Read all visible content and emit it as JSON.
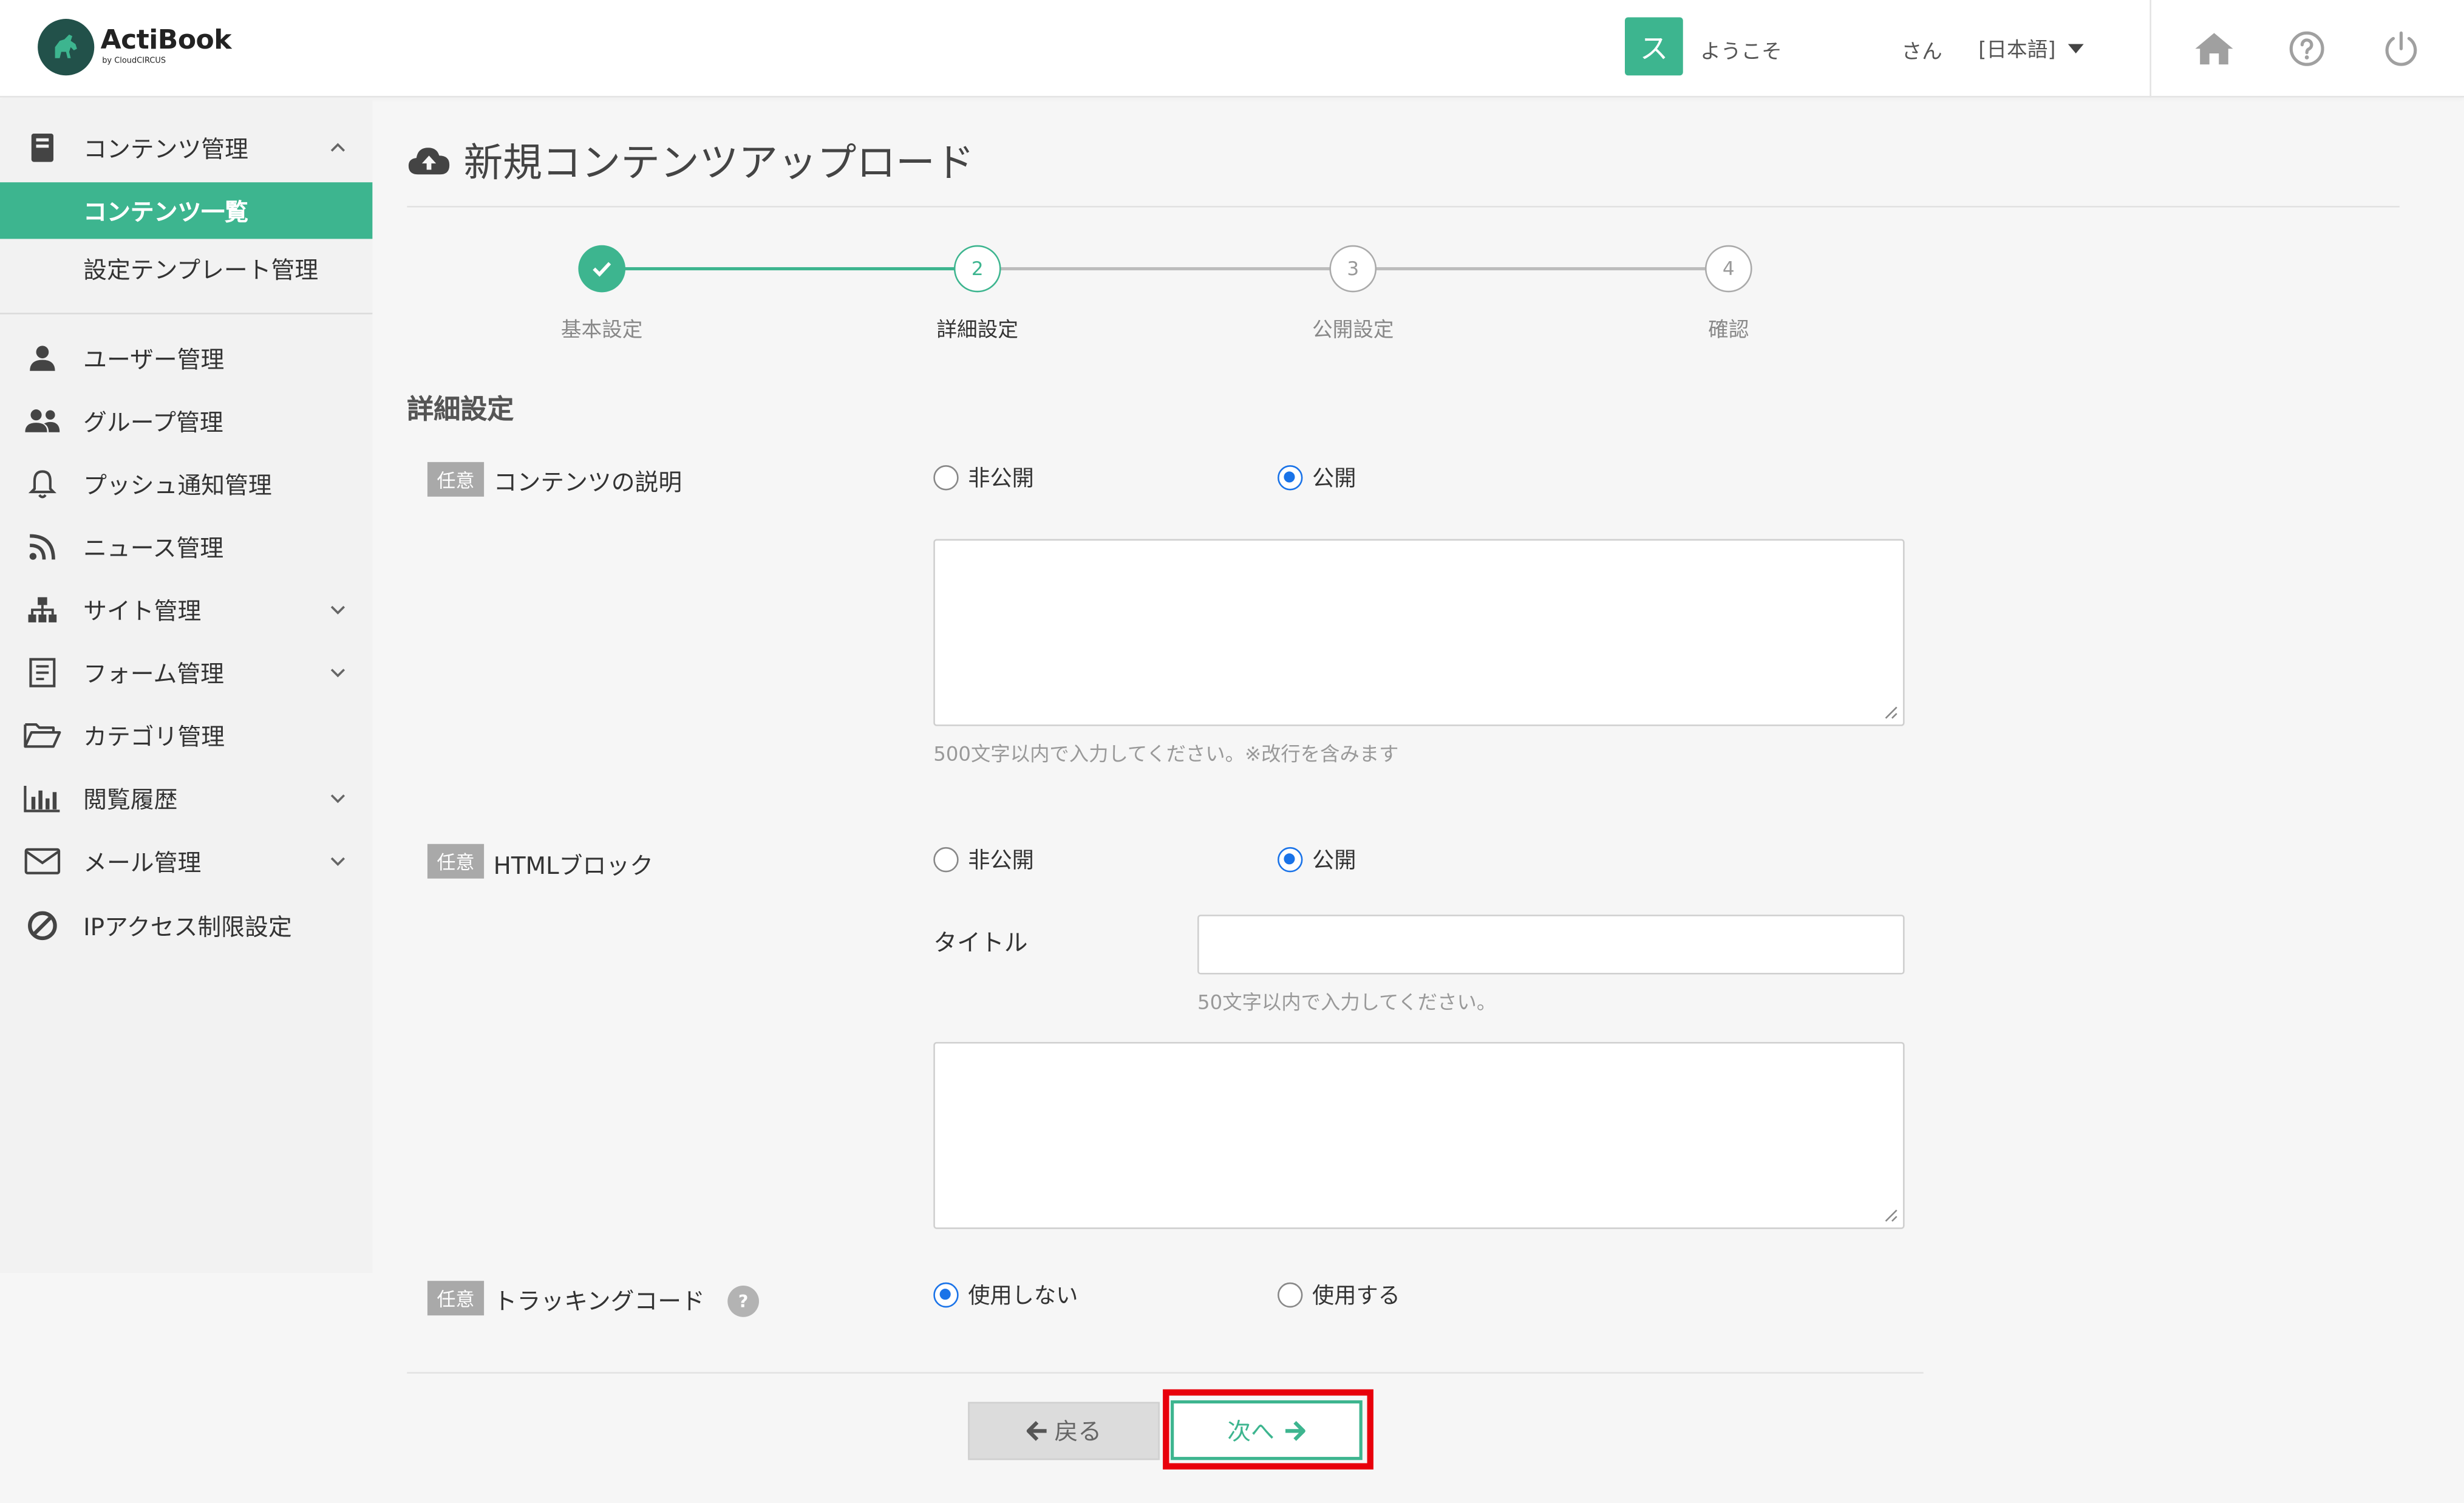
{
  "header": {
    "logo_name": "ActiBook",
    "logo_sub": "by CloudCIRCUS",
    "user_initial": "ス",
    "welcome_text": "ようこそ",
    "honorific": "さん",
    "language": "[日本語]"
  },
  "sidebar": {
    "content_mgmt": "コンテンツ管理",
    "content_list": "コンテンツ一覧",
    "template_mgmt": "設定テンプレート管理",
    "items": [
      {
        "label": "ユーザー管理",
        "icon": "user-icon"
      },
      {
        "label": "グループ管理",
        "icon": "users-icon"
      },
      {
        "label": "プッシュ通知管理",
        "icon": "bell-icon"
      },
      {
        "label": "ニュース管理",
        "icon": "rss-icon"
      },
      {
        "label": "サイト管理",
        "icon": "sitemap-icon"
      },
      {
        "label": "フォーム管理",
        "icon": "form-icon"
      },
      {
        "label": "カテゴリ管理",
        "icon": "folder-icon"
      },
      {
        "label": "閲覧履歴",
        "icon": "bar-chart-icon"
      },
      {
        "label": "メール管理",
        "icon": "mail-icon"
      },
      {
        "label": "IPアクセス制限設定",
        "icon": "ban-icon"
      }
    ]
  },
  "main": {
    "title": "新規コンテンツアップロード",
    "steps": [
      {
        "num": "",
        "label": "基本設定",
        "state": "done"
      },
      {
        "num": "2",
        "label": "詳細設定",
        "state": "current"
      },
      {
        "num": "3",
        "label": "公開設定",
        "state": "todo"
      },
      {
        "num": "4",
        "label": "確認",
        "state": "todo"
      }
    ],
    "section_heading": "詳細設定",
    "optional_badge": "任意",
    "description": {
      "label": "コンテンツの説明",
      "private_label": "非公開",
      "public_label": "公開",
      "selected": "公開",
      "value": "",
      "hint": "500文字以内で入力してください。※改行を含みます"
    },
    "html_block": {
      "label": "HTMLブロック",
      "private_label": "非公開",
      "public_label": "公開",
      "selected": "公開",
      "title_label": "タイトル",
      "title_value": "",
      "title_hint": "50文字以内で入力してください。",
      "body_value": ""
    },
    "tracking": {
      "label": "トラッキングコード",
      "help": "?",
      "no_label": "使用しない",
      "yes_label": "使用する",
      "selected": "使用しない"
    },
    "back_button": "戻る",
    "next_button": "次へ"
  },
  "colors": {
    "accent": "#3db58f",
    "radio": "#1a73e8",
    "highlight": "#e8000b"
  }
}
